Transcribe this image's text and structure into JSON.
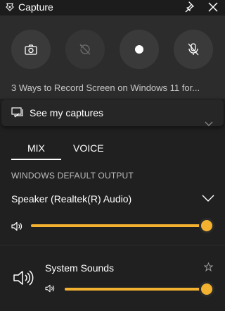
{
  "window": {
    "title": "Capture",
    "icons": {
      "app": "capture-widget-icon",
      "pin": "pin-icon",
      "close": "close-icon"
    }
  },
  "capture": {
    "buttons": [
      {
        "name": "screenshot",
        "icon": "camera-icon",
        "enabled": true
      },
      {
        "name": "record-last-30s",
        "icon": "history-disabled-icon",
        "enabled": false
      },
      {
        "name": "start-recording",
        "icon": "record-dot-icon",
        "enabled": true
      },
      {
        "name": "microphone",
        "icon": "mic-off-icon",
        "enabled": true
      }
    ],
    "description": "3 Ways to Record Screen on Windows 11 for..."
  },
  "see_captures": {
    "label": "See my captures",
    "icon": "gallery-icon"
  },
  "audio": {
    "tabs": [
      {
        "label": "MIX",
        "selected": true
      },
      {
        "label": "VOICE",
        "selected": false
      }
    ],
    "section_label": "WINDOWS DEFAULT OUTPUT",
    "device": {
      "name": "Speaker (Realtek(R) Audio)",
      "volume": 1.0
    },
    "apps": [
      {
        "name": "System Sounds",
        "icon": "speaker-icon",
        "volume": 1.0,
        "favorite": false
      }
    ]
  },
  "colors": {
    "accent": "#f2b230",
    "background": "#202020",
    "panel": "#2c2c2c",
    "button": "#3a3a3a"
  }
}
